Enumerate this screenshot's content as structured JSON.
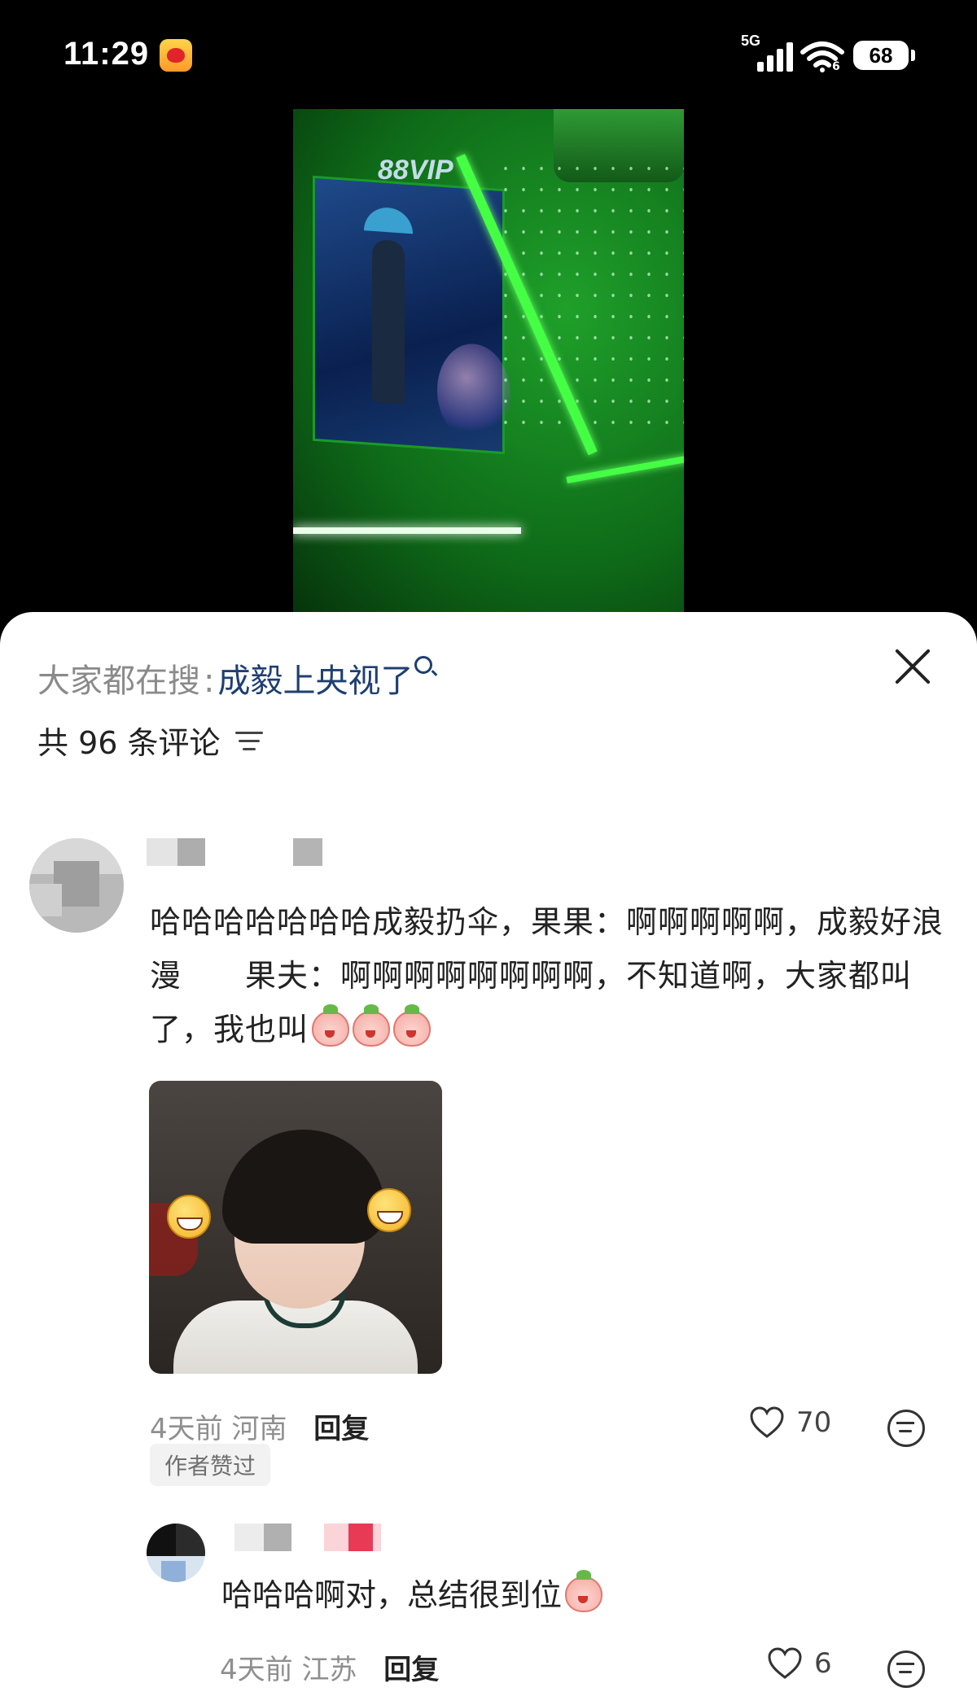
{
  "status_bar": {
    "time": "11:29",
    "network": "5G",
    "wifi_sub": "6",
    "battery": "68"
  },
  "icons": [
    "weibo-app-icon",
    "signal-icon",
    "wifi-icon",
    "battery-icon",
    "search-icon",
    "close-icon",
    "sort-icon",
    "heart-icon",
    "react-icon"
  ],
  "sheet": {
    "search_prefix": "大家都在搜",
    "search_separator": ":",
    "search_query": "成毅上央视了",
    "comment_count": "共 96 条评论"
  },
  "comments": [
    {
      "text": "哈哈哈哈哈哈哈成毅扔伞，果果：啊啊啊啊啊，成毅好浪漫　　果夫：啊啊啊啊啊啊啊啊，不知道啊，大家都叫了，我也叫",
      "time": "4天前",
      "location": "河南",
      "reply_label": "回复",
      "likes": "70",
      "author_liked": "作者赞过"
    },
    {
      "text": "哈哈哈啊对，总结很到位",
      "time": "4天前",
      "location": "江苏",
      "reply_label": "回复",
      "likes": "6"
    }
  ],
  "colors": {
    "query_blue": "#1f3f72",
    "meta_gray": "#8f8f8f",
    "sheet_bg": "#ffffff"
  }
}
